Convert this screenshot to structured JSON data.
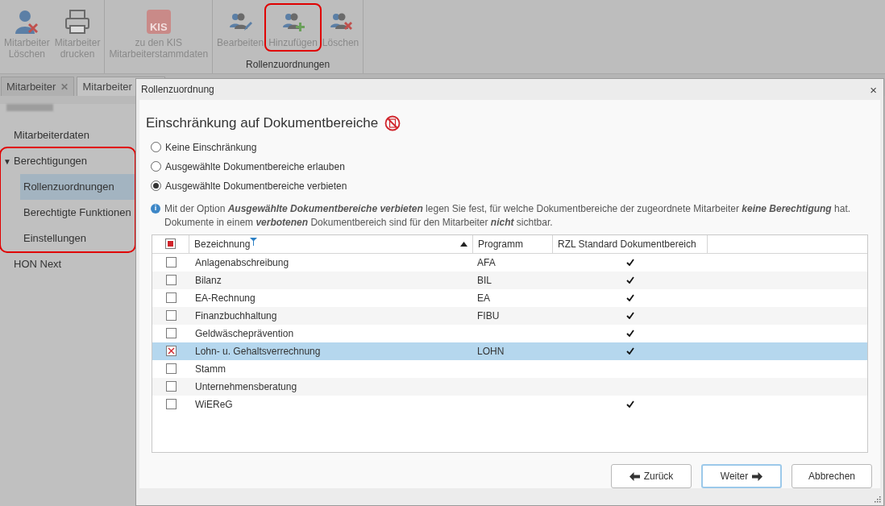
{
  "toolbar": {
    "groups": [
      {
        "buttons": [
          {
            "kind": "user-delete",
            "label": "Mitarbeiter\nLöschen",
            "highlighted": false
          },
          {
            "kind": "print",
            "label": "Mitarbeiter\ndrucken",
            "highlighted": false
          }
        ]
      },
      {
        "buttons": [
          {
            "kind": "kis",
            "icon_text": "KIS",
            "label": "zu den KIS\nMitarbeiterstammdaten",
            "highlighted": false
          }
        ]
      },
      {
        "title": "Rollenzuordnungen",
        "buttons": [
          {
            "kind": "group-edit",
            "label": "Bearbeiten",
            "highlighted": false
          },
          {
            "kind": "group-add",
            "label": "Hinzufügen",
            "highlighted": true
          },
          {
            "kind": "group-delete",
            "label": "Löschen",
            "highlighted": false
          }
        ]
      }
    ]
  },
  "tabs": [
    {
      "label": "Mitarbeiter",
      "selected": false,
      "close_icon": "✕"
    },
    {
      "label": "Mitarbeiter",
      "selected": true
    }
  ],
  "sidebar": {
    "items": [
      {
        "label": "Mitarbeiterdaten",
        "selected": false,
        "highlighted": false
      },
      {
        "label": "Berechtigungen",
        "toggle": "▼",
        "expanded": true,
        "selected": false,
        "highlighted": true,
        "children": [
          {
            "label": "Rollenzuordnungen",
            "selected": true
          },
          {
            "label": "Berechtigte Funktionen",
            "selected": false
          },
          {
            "label": "Einstellungen",
            "selected": false
          }
        ]
      },
      {
        "label": "HON Next",
        "selected": false,
        "highlighted": false
      }
    ]
  },
  "dialog": {
    "title": "Rollenzuordnung",
    "close": "×",
    "heading": "Einschränkung auf Dokumentbereiche",
    "options": [
      {
        "label": "Keine Einschränkung",
        "selected": false
      },
      {
        "label": "Ausgewählte Dokumentbereiche erlauben",
        "selected": false
      },
      {
        "label": "Ausgewählte Dokumentbereiche verbieten",
        "selected": true
      }
    ],
    "info_icon": "i",
    "info": "Mit der Option **Ausgewählte Dokumentbereiche verbieten** legen Sie fest, für welche Dokumentbereiche der zugeordnete Mitarbeiter **keine Berechtigung** hat. Dokumente in einem **verbotenen** Dokumentbereich sind für den Mitarbeiter **nicht** sichtbar.",
    "table": {
      "all_partial": true,
      "columns": [
        {
          "label": "Bezeichnung",
          "filter": true,
          "sorted_ascending": true
        },
        {
          "label": "Programm"
        },
        {
          "label": "RZL Standard Dokumentbereich"
        }
      ],
      "rows": [
        {
          "name": "Anlagenabschreibung",
          "program": "AFA",
          "standard": true,
          "checked": false,
          "selected": false
        },
        {
          "name": "Bilanz",
          "program": "BIL",
          "standard": true,
          "checked": false,
          "selected": false
        },
        {
          "name": "EA-Rechnung",
          "program": "EA",
          "standard": true,
          "checked": false,
          "selected": false
        },
        {
          "name": "Finanzbuchhaltung",
          "program": "FIBU",
          "standard": true,
          "checked": false,
          "selected": false
        },
        {
          "name": "Geldwäscheprävention",
          "standard": true,
          "checked": false,
          "selected": false
        },
        {
          "name": "Lohn- u. Gehaltsverrechnung",
          "program": "LOHN",
          "standard": true,
          "checked": true,
          "selected": true
        },
        {
          "name": "Stamm",
          "standard": false,
          "checked": false,
          "selected": false
        },
        {
          "name": "Unternehmensberatung",
          "standard": false,
          "checked": false,
          "selected": false
        },
        {
          "name": "WiEReG",
          "standard": true,
          "checked": false,
          "selected": false
        }
      ]
    },
    "buttons": [
      {
        "kind": "back",
        "label": "Zurück",
        "focused": false
      },
      {
        "kind": "next",
        "label": "Weiter",
        "focused": true
      },
      {
        "kind": "cancel",
        "label": "Abbrechen",
        "focused": false
      }
    ]
  }
}
